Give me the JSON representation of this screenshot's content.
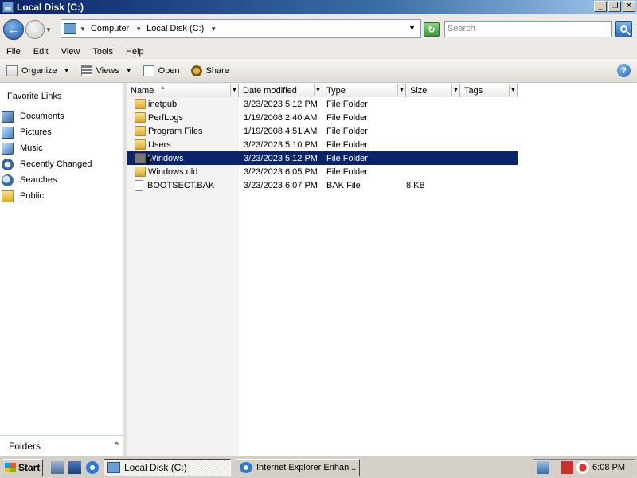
{
  "window": {
    "title": "Local Disk (C:)",
    "min_label": "_",
    "max_label": "❐",
    "close_label": "✕"
  },
  "address": {
    "crumbs": [
      "Computer",
      "Local Disk (C:)"
    ],
    "search_placeholder": "Search"
  },
  "menu": [
    "File",
    "Edit",
    "View",
    "Tools",
    "Help"
  ],
  "commands": {
    "organize": "Organize",
    "views": "Views",
    "open": "Open",
    "share": "Share"
  },
  "nav": {
    "favorites_title": "Favorite Links",
    "items": [
      "Documents",
      "Pictures",
      "Music",
      "Recently Changed",
      "Searches",
      "Public"
    ],
    "folders_label": "Folders"
  },
  "columns": {
    "name": "Name",
    "date": "Date modified",
    "type": "Type",
    "size": "Size",
    "tags": "Tags"
  },
  "files": [
    {
      "name": "inetpub",
      "date": "3/23/2023 5:12 PM",
      "type": "File Folder",
      "size": "",
      "kind": "folder"
    },
    {
      "name": "PerfLogs",
      "date": "1/19/2008 2:40 AM",
      "type": "File Folder",
      "size": "",
      "kind": "folder"
    },
    {
      "name": "Program Files",
      "date": "1/19/2008 4:51 AM",
      "type": "File Folder",
      "size": "",
      "kind": "folder"
    },
    {
      "name": "Users",
      "date": "3/23/2023 5:10 PM",
      "type": "File Folder",
      "size": "",
      "kind": "folder"
    },
    {
      "name": "Windows",
      "date": "3/23/2023 5:12 PM",
      "type": "File Folder",
      "size": "",
      "kind": "folder",
      "selected": true
    },
    {
      "name": "Windows.old",
      "date": "3/23/2023 6:05 PM",
      "type": "File Folder",
      "size": "",
      "kind": "folder"
    },
    {
      "name": "BOOTSECT.BAK",
      "date": "3/23/2023 6:07 PM",
      "type": "BAK File",
      "size": "8 KB",
      "kind": "file"
    }
  ],
  "taskbar": {
    "start_label": "Start",
    "tasks": [
      "Local Disk (C:)",
      "Internet Explorer Enhan..."
    ],
    "clock": "6:08 PM"
  },
  "colors": {
    "selection": "#0a246a",
    "titlebar": "#0a246a"
  }
}
